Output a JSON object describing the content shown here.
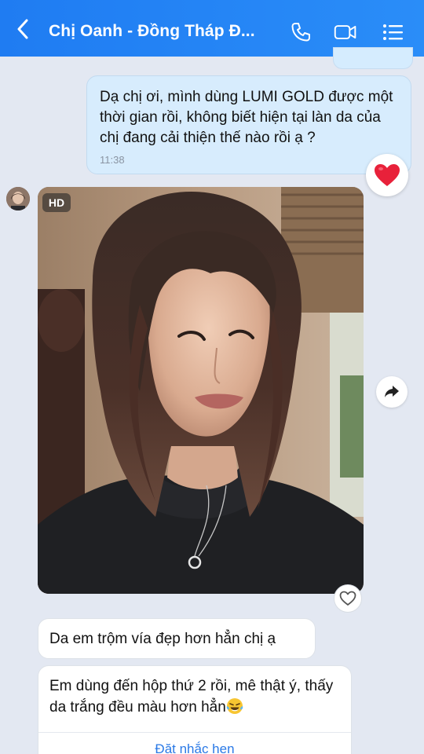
{
  "header": {
    "title": "Chị Oanh - Đồng Tháp Đ...",
    "bg_color": "#2188f5",
    "icons": [
      "chevron-left-icon",
      "phone-icon",
      "video-icon",
      "list-menu-icon"
    ]
  },
  "messages": {
    "outgoing": {
      "text": "Dạ chị ơi, mình dùng LUMI GOLD được một thời gian rồi, không biết hiện tại làn da của chị đang cải thiện thế nào rồi ạ ?",
      "time": "11:38",
      "reaction": "heart-icon"
    },
    "photo": {
      "badge": "HD"
    },
    "incoming_1": {
      "text": "Da em trộm vía đẹp hơn hẳn chị ạ"
    },
    "incoming_2": {
      "text": "Em dùng đến hộp thứ 2 rồi, mê thật ý, thấy da trắng đều màu hơn hẳn",
      "emoji": "tears-of-joy-emoji",
      "action_label": "Đặt nhắc hẹn"
    }
  },
  "colors": {
    "accent": "#1f7cf2",
    "outgoing_bubble": "#d7ecfd",
    "reaction_heart": "#e8213a",
    "link": "#2a79e6"
  }
}
